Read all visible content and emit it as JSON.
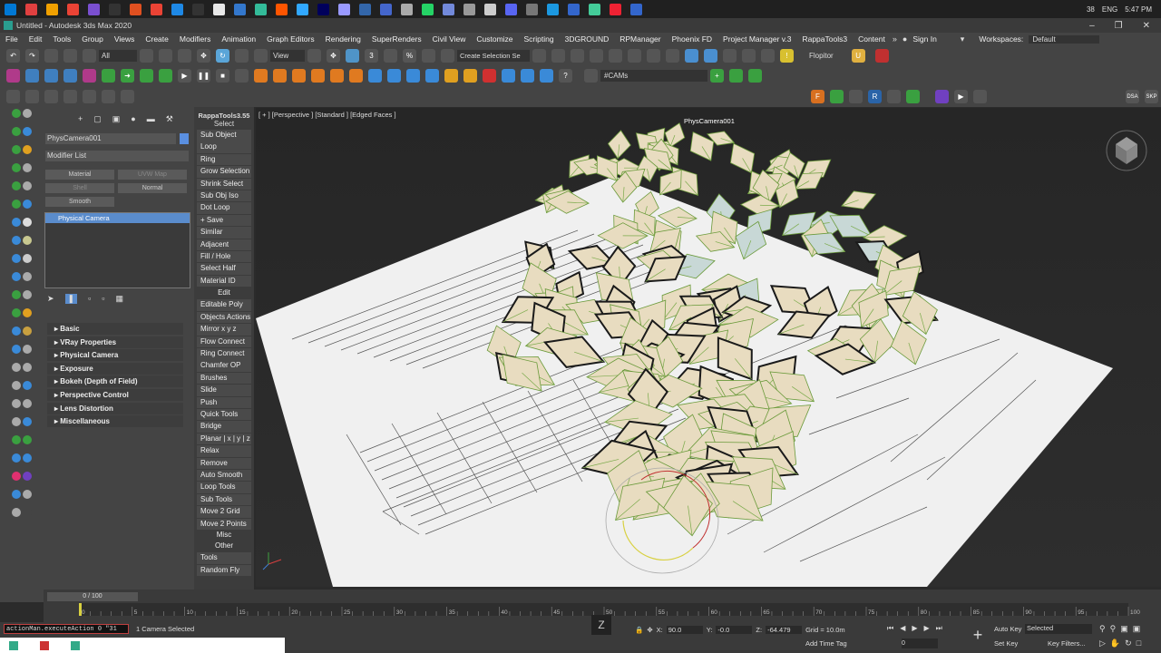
{
  "taskbar": {
    "tray_count": "38",
    "lang": "ENG",
    "time": "5:47 PM",
    "colors": [
      "#0078d4",
      "#e04040",
      "#f0a000",
      "#ea4335",
      "#7a4fd0",
      "#333",
      "#e05020",
      "#ea4335",
      "#1e88e5",
      "#333",
      "#e8e8e8",
      "#37c",
      "#3b9",
      "#ff5500",
      "#31a8ff",
      "#00005b",
      "#9999ff",
      "#36a",
      "#46c",
      "#aaa",
      "#25d366",
      "#7289da",
      "#999",
      "#ccc",
      "#5865f2",
      "#777",
      "#1b98e0",
      "#36c",
      "#4c9",
      "#e23",
      "#36c"
    ]
  },
  "window": {
    "title": "Untitled - Autodesk 3ds Max 2020"
  },
  "menubar": {
    "items": [
      "File",
      "Edit",
      "Tools",
      "Group",
      "Views",
      "Create",
      "Modifiers",
      "Animation",
      "Graph Editors",
      "Rendering",
      "SuperRenders",
      "Civil View",
      "Customize",
      "Scripting",
      "3DGROUND",
      "RPManager",
      "Phoenix FD",
      "Project Manager v.3",
      "RappaTools3",
      "Content"
    ],
    "sign_in": "Sign In",
    "workspaces_label": "Workspaces:",
    "workspace": "Default"
  },
  "toolbar1": {
    "filter": "All",
    "view": "View",
    "selection_set": "Create Selection Se",
    "flopitor": "Flopitor"
  },
  "toolbar2": {
    "cams": "#CAMs"
  },
  "command_panel": {
    "object_name": "PhysCamera001",
    "modifier_list": "Modifier List",
    "buttons": [
      "Material",
      "UVW Map",
      "Shell",
      "Normal",
      "Smooth"
    ],
    "stack_item": "Physical Camera",
    "rollouts": [
      "Basic",
      "VRay Properties",
      "Physical Camera",
      "Exposure",
      "Bokeh (Depth of Field)",
      "Perspective Control",
      "Lens Distortion",
      "Miscellaneous"
    ]
  },
  "rappa": {
    "title": "RappaTools3.55",
    "select_label": "Select",
    "items": [
      "Sub Object",
      "Loop",
      "Ring",
      "Grow Selection",
      "Shrink Select",
      "Sub Obj Iso",
      "Dot Loop",
      "+ Save",
      "Similar",
      "Adjacent",
      "Fill / Hole",
      "Select Half",
      "Material ID"
    ],
    "edit_label": "Edit",
    "edit_items": [
      "Editable Poly",
      "Objects Actions",
      "Mirror x y z",
      "Flow Connect",
      "Ring Connect",
      "Chamfer OP",
      "Brushes",
      "Slide",
      "Push",
      "Quick Tools",
      "Bridge",
      "Planar | x | y | z",
      "Relax",
      "Remove",
      "Auto Smooth",
      "Loop Tools",
      "Sub Tools",
      "Move 2 Grid",
      "Move 2 Points"
    ],
    "misc_label": "Misc",
    "other_label": "Other",
    "other_items": [
      "Tools",
      "Random Fly"
    ]
  },
  "viewport": {
    "label": "[ + ] [Perspective ] [Standard ] [Edged Faces ]",
    "camera_name": "PhysCamera001"
  },
  "timeline": {
    "frame": "0 / 100",
    "ticks": [
      "0",
      "5",
      "10",
      "15",
      "20",
      "25",
      "30",
      "35",
      "40",
      "45",
      "50",
      "55",
      "60",
      "65",
      "70",
      "75",
      "80",
      "85",
      "90",
      "95",
      "100"
    ],
    "position": 0.0
  },
  "status": {
    "script": "actionMan.executeAction 0 \"31",
    "selected": "1 Camera Selected",
    "x_label": "X:",
    "x": "90.0",
    "y_label": "Y:",
    "y": "-0.0",
    "z_label": "Z:",
    "z": "-64.479",
    "grid": "Grid = 10.0m",
    "add_time_tag": "Add Time Tag",
    "auto_key": "Auto Key",
    "set_key": "Set Key",
    "selected_dd": "Selected",
    "key_filters": "Key Filters...",
    "frame_field": "0"
  }
}
